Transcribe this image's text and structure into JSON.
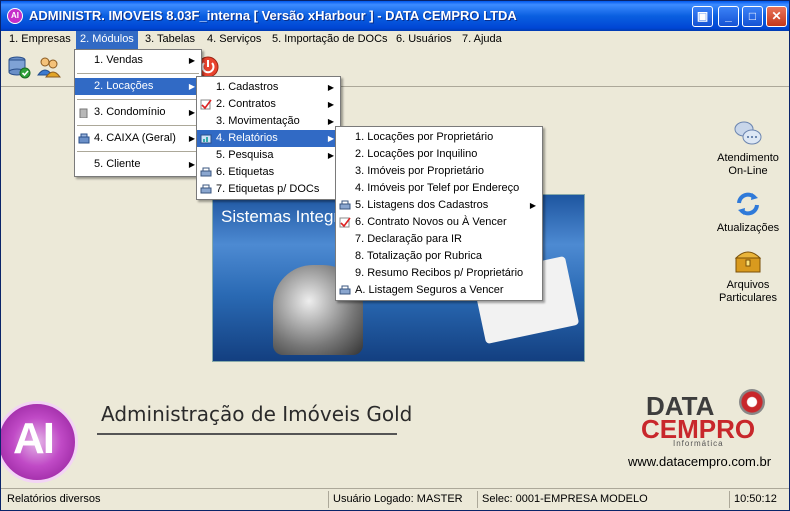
{
  "window": {
    "title": "ADMINISTR. IMOVEIS  8.03F_interna [ Versão xHarbour ]  -  DATA CEMPRO LTDA",
    "app_icon_text": "AI"
  },
  "menubar": [
    "1. Empresas",
    "2. Módulos",
    "3. Tabelas",
    "4. Serviços",
    "5. Importação de DOCs",
    "6. Usuários",
    "7. Ajuda"
  ],
  "menu_modulos": [
    "1. Vendas",
    "2. Locações",
    "3. Condomínio",
    "4. CAIXA  (Geral)",
    "5. Cliente"
  ],
  "menu_locacoes": [
    "1. Cadastros",
    "2. Contratos",
    "3. Movimentação",
    "4. Relatórios",
    "5. Pesquisa",
    "6. Etiquetas",
    "7. Etiquetas p/ DOCs"
  ],
  "menu_relatorios": [
    "1. Locações por Proprietário",
    "2. Locações por Inquilino",
    "3. Imóveis por Proprietário",
    "4. Imóveis por Telef por Endereço",
    "5. Listagens dos Cadastros",
    "6. Contrato Novos ou À Vencer",
    "7. Declaração para IR",
    "8. Totalização por Rubrica",
    "9. Resumo Recibos p/ Proprietário",
    "A. Listagem Seguros a Vencer"
  ],
  "banner": {
    "text": "Sistemas Integr"
  },
  "side_items": [
    {
      "label": "Atendimento On-Line",
      "icon": "chat-bubbles-icon"
    },
    {
      "label": "Atualizações",
      "icon": "refresh-arrows-icon"
    },
    {
      "label": "Arquivos Particulares",
      "icon": "treasure-box-icon"
    }
  ],
  "branding": {
    "app_title": "Administração de Imóveis Gold",
    "logo_letters": "AI",
    "company_data": "DATA",
    "company_cempro": "CEMPRO",
    "company_tag": "Informática",
    "website": "www.datacempro.com.br"
  },
  "status": {
    "message": "Relatórios diversos",
    "user": "Usuário Logado: MASTER",
    "company": "Selec: 0001-EMPRESA MODELO",
    "time": "10:50:12"
  },
  "colors": {
    "title_bar": "#0a5fe0",
    "menu_highlight": "#316ac5",
    "brand_red": "#c8272b",
    "logo_purple": "#c04ac6"
  }
}
